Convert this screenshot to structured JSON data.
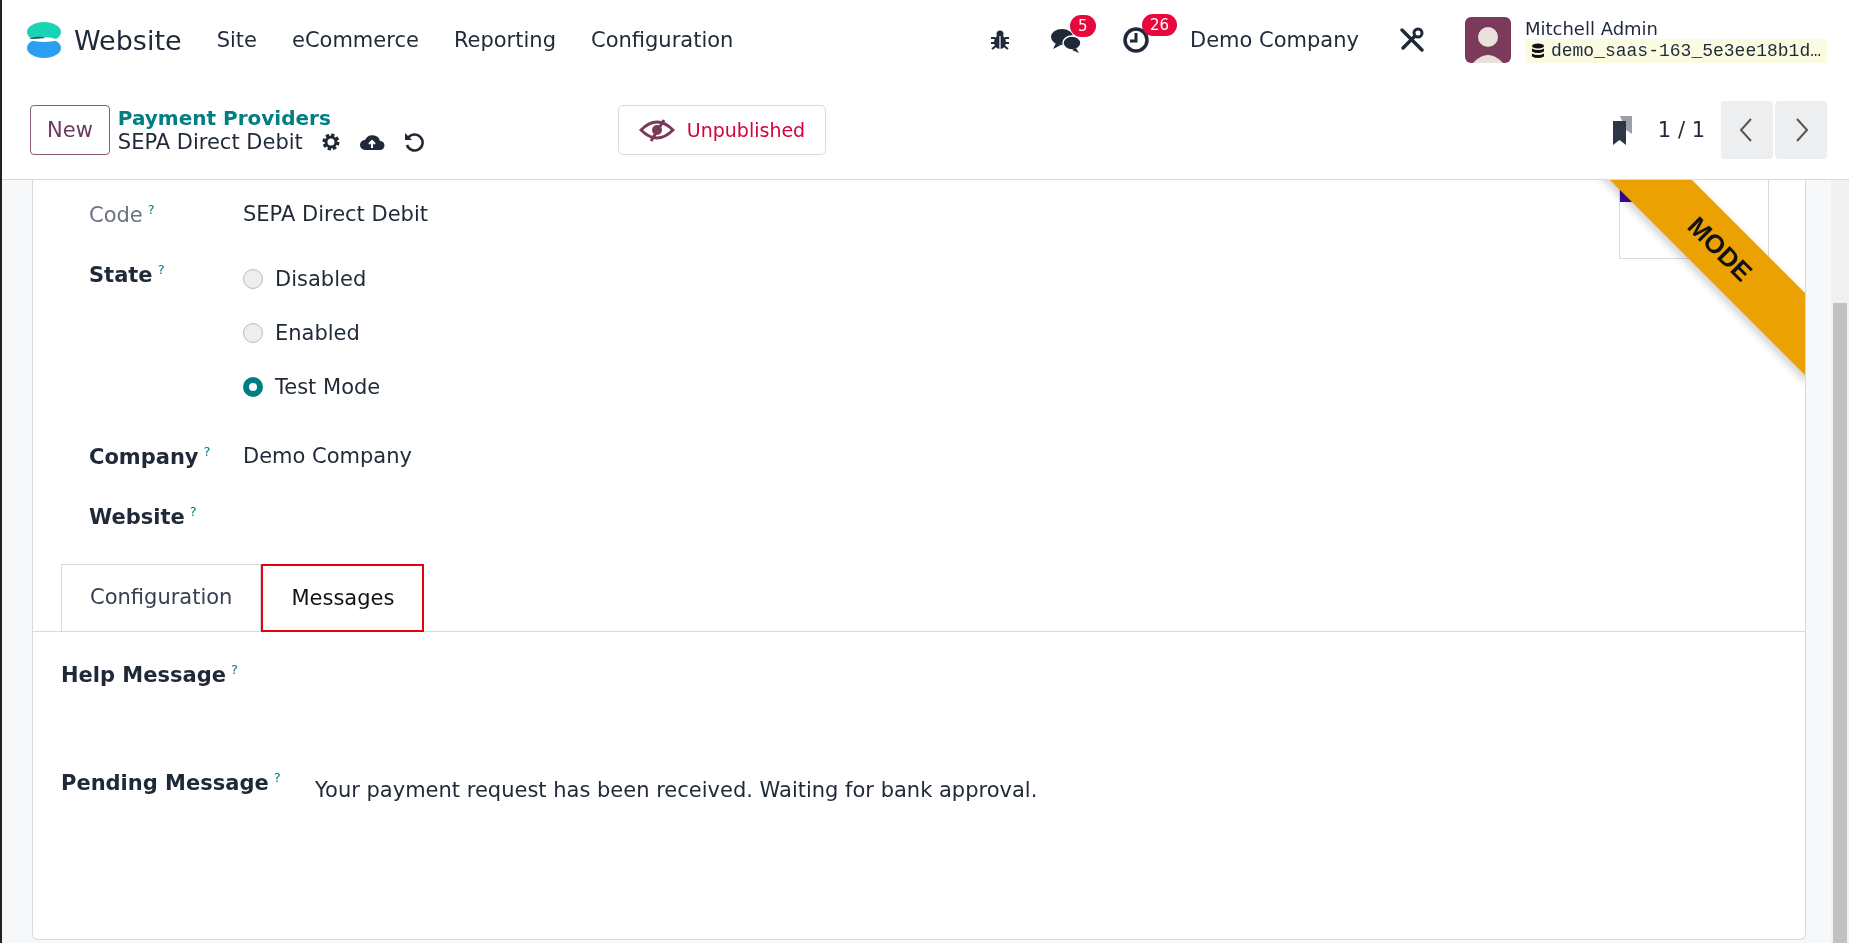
{
  "navbar": {
    "app": "Website",
    "menu": [
      "Site",
      "eCommerce",
      "Reporting",
      "Configuration"
    ],
    "messages_count": "5",
    "activities_count": "26",
    "company": "Demo Company",
    "user": "Mitchell Admin",
    "database": "demo_saas-163_5e3ee18b1d…"
  },
  "control_panel": {
    "new_button": "New",
    "breadcrumb": "Payment Providers",
    "record": "SEPA Direct Debit",
    "publish_state": "Unpublished",
    "pager": "1 / 1"
  },
  "ribbon": "MODE",
  "fields": [
    {
      "kind": "text",
      "label": "Code",
      "help": "?",
      "value": "SEPA Direct Debit"
    },
    {
      "kind": "radio",
      "label": "State",
      "help": "?",
      "options": [
        {
          "label": "Disabled",
          "selected": false
        },
        {
          "label": "Enabled",
          "selected": false
        },
        {
          "label": "Test Mode",
          "selected": true
        }
      ]
    },
    {
      "kind": "text",
      "label": "Company",
      "help": "?",
      "value": "Demo Company"
    },
    {
      "kind": "text",
      "label": "Website",
      "help": "?"
    }
  ],
  "tabs": [
    {
      "label": "Configuration",
      "selected": false,
      "highlighted": false
    },
    {
      "label": "Messages",
      "selected": true,
      "highlighted": true
    }
  ],
  "messages": [
    {
      "label": "Help Message",
      "help": "?"
    },
    {
      "label": "Pending Message",
      "help": "?",
      "value": "Your payment request has been received. Waiting for bank approval."
    }
  ]
}
